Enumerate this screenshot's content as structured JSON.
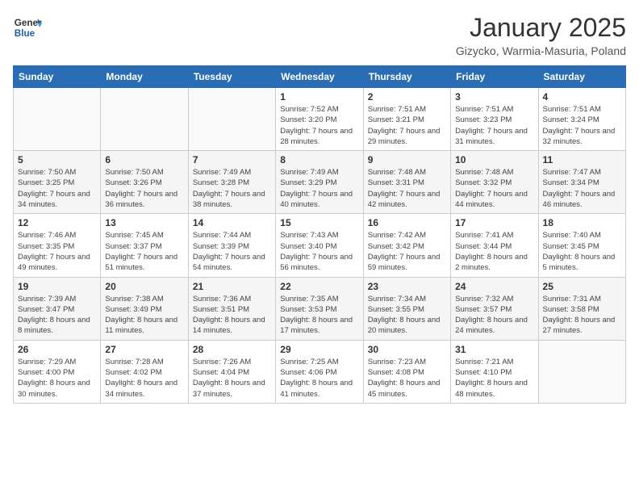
{
  "header": {
    "logo_general": "General",
    "logo_blue": "Blue",
    "title": "January 2025",
    "subtitle": "Gizycko, Warmia-Masuria, Poland"
  },
  "weekdays": [
    "Sunday",
    "Monday",
    "Tuesday",
    "Wednesday",
    "Thursday",
    "Friday",
    "Saturday"
  ],
  "weeks": [
    [
      {
        "day": "",
        "info": ""
      },
      {
        "day": "",
        "info": ""
      },
      {
        "day": "",
        "info": ""
      },
      {
        "day": "1",
        "info": "Sunrise: 7:52 AM\nSunset: 3:20 PM\nDaylight: 7 hours\nand 28 minutes."
      },
      {
        "day": "2",
        "info": "Sunrise: 7:51 AM\nSunset: 3:21 PM\nDaylight: 7 hours\nand 29 minutes."
      },
      {
        "day": "3",
        "info": "Sunrise: 7:51 AM\nSunset: 3:23 PM\nDaylight: 7 hours\nand 31 minutes."
      },
      {
        "day": "4",
        "info": "Sunrise: 7:51 AM\nSunset: 3:24 PM\nDaylight: 7 hours\nand 32 minutes."
      }
    ],
    [
      {
        "day": "5",
        "info": "Sunrise: 7:50 AM\nSunset: 3:25 PM\nDaylight: 7 hours\nand 34 minutes."
      },
      {
        "day": "6",
        "info": "Sunrise: 7:50 AM\nSunset: 3:26 PM\nDaylight: 7 hours\nand 36 minutes."
      },
      {
        "day": "7",
        "info": "Sunrise: 7:49 AM\nSunset: 3:28 PM\nDaylight: 7 hours\nand 38 minutes."
      },
      {
        "day": "8",
        "info": "Sunrise: 7:49 AM\nSunset: 3:29 PM\nDaylight: 7 hours\nand 40 minutes."
      },
      {
        "day": "9",
        "info": "Sunrise: 7:48 AM\nSunset: 3:31 PM\nDaylight: 7 hours\nand 42 minutes."
      },
      {
        "day": "10",
        "info": "Sunrise: 7:48 AM\nSunset: 3:32 PM\nDaylight: 7 hours\nand 44 minutes."
      },
      {
        "day": "11",
        "info": "Sunrise: 7:47 AM\nSunset: 3:34 PM\nDaylight: 7 hours\nand 46 minutes."
      }
    ],
    [
      {
        "day": "12",
        "info": "Sunrise: 7:46 AM\nSunset: 3:35 PM\nDaylight: 7 hours\nand 49 minutes."
      },
      {
        "day": "13",
        "info": "Sunrise: 7:45 AM\nSunset: 3:37 PM\nDaylight: 7 hours\nand 51 minutes."
      },
      {
        "day": "14",
        "info": "Sunrise: 7:44 AM\nSunset: 3:39 PM\nDaylight: 7 hours\nand 54 minutes."
      },
      {
        "day": "15",
        "info": "Sunrise: 7:43 AM\nSunset: 3:40 PM\nDaylight: 7 hours\nand 56 minutes."
      },
      {
        "day": "16",
        "info": "Sunrise: 7:42 AM\nSunset: 3:42 PM\nDaylight: 7 hours\nand 59 minutes."
      },
      {
        "day": "17",
        "info": "Sunrise: 7:41 AM\nSunset: 3:44 PM\nDaylight: 8 hours\nand 2 minutes."
      },
      {
        "day": "18",
        "info": "Sunrise: 7:40 AM\nSunset: 3:45 PM\nDaylight: 8 hours\nand 5 minutes."
      }
    ],
    [
      {
        "day": "19",
        "info": "Sunrise: 7:39 AM\nSunset: 3:47 PM\nDaylight: 8 hours\nand 8 minutes."
      },
      {
        "day": "20",
        "info": "Sunrise: 7:38 AM\nSunset: 3:49 PM\nDaylight: 8 hours\nand 11 minutes."
      },
      {
        "day": "21",
        "info": "Sunrise: 7:36 AM\nSunset: 3:51 PM\nDaylight: 8 hours\nand 14 minutes."
      },
      {
        "day": "22",
        "info": "Sunrise: 7:35 AM\nSunset: 3:53 PM\nDaylight: 8 hours\nand 17 minutes."
      },
      {
        "day": "23",
        "info": "Sunrise: 7:34 AM\nSunset: 3:55 PM\nDaylight: 8 hours\nand 20 minutes."
      },
      {
        "day": "24",
        "info": "Sunrise: 7:32 AM\nSunset: 3:57 PM\nDaylight: 8 hours\nand 24 minutes."
      },
      {
        "day": "25",
        "info": "Sunrise: 7:31 AM\nSunset: 3:58 PM\nDaylight: 8 hours\nand 27 minutes."
      }
    ],
    [
      {
        "day": "26",
        "info": "Sunrise: 7:29 AM\nSunset: 4:00 PM\nDaylight: 8 hours\nand 30 minutes."
      },
      {
        "day": "27",
        "info": "Sunrise: 7:28 AM\nSunset: 4:02 PM\nDaylight: 8 hours\nand 34 minutes."
      },
      {
        "day": "28",
        "info": "Sunrise: 7:26 AM\nSunset: 4:04 PM\nDaylight: 8 hours\nand 37 minutes."
      },
      {
        "day": "29",
        "info": "Sunrise: 7:25 AM\nSunset: 4:06 PM\nDaylight: 8 hours\nand 41 minutes."
      },
      {
        "day": "30",
        "info": "Sunrise: 7:23 AM\nSunset: 4:08 PM\nDaylight: 8 hours\nand 45 minutes."
      },
      {
        "day": "31",
        "info": "Sunrise: 7:21 AM\nSunset: 4:10 PM\nDaylight: 8 hours\nand 48 minutes."
      },
      {
        "day": "",
        "info": ""
      }
    ]
  ]
}
